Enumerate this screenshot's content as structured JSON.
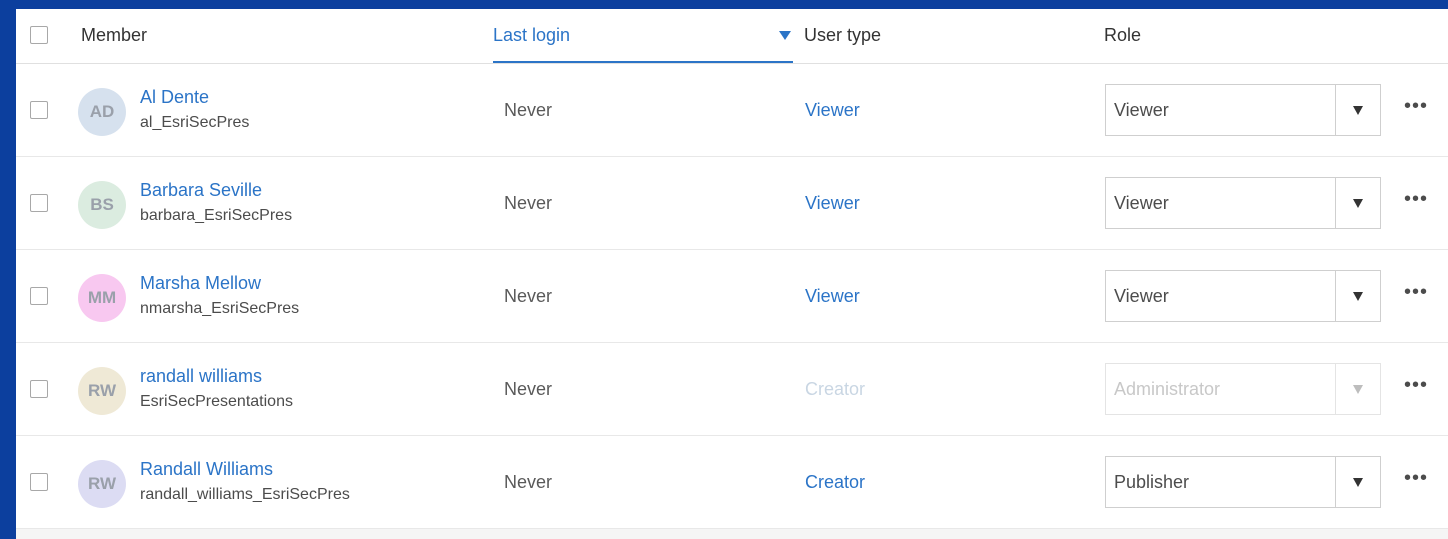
{
  "header": {
    "member": "Member",
    "last_login": "Last login",
    "user_type": "User type",
    "role": "Role"
  },
  "rows": [
    {
      "initials": "AD",
      "avatar_color": "#d6e1ee",
      "name": "Al Dente",
      "username": "al_EsriSecPres",
      "last_login": "Never",
      "user_type": "Viewer",
      "role": "Viewer",
      "disabled": false
    },
    {
      "initials": "BS",
      "avatar_color": "#dbece0",
      "name": "Barbara Seville",
      "username": "barbara_EsriSecPres",
      "last_login": "Never",
      "user_type": "Viewer",
      "role": "Viewer",
      "disabled": false
    },
    {
      "initials": "MM",
      "avatar_color": "#f8c8f0",
      "name": "Marsha Mellow",
      "username": "nmarsha_EsriSecPres",
      "last_login": "Never",
      "user_type": "Viewer",
      "role": "Viewer",
      "disabled": false
    },
    {
      "initials": "RW",
      "avatar_color": "#efe9d6",
      "name": "randall williams",
      "username": "EsriSecPresentations",
      "last_login": "Never",
      "user_type": "Creator",
      "role": "Administrator",
      "disabled": true
    },
    {
      "initials": "RW",
      "avatar_color": "#dcdcf3",
      "name": "Randall Williams",
      "username": "randall_williams_EsriSecPres",
      "last_login": "Never",
      "user_type": "Creator",
      "role": "Publisher",
      "disabled": false
    }
  ],
  "icons": {
    "sort": "sort-descending-icon",
    "dropdown": "chevron-down-icon",
    "more": "more-horizontal-icon"
  },
  "colors": {
    "accent": "#2b74c7",
    "background": "#0c3f9e"
  }
}
